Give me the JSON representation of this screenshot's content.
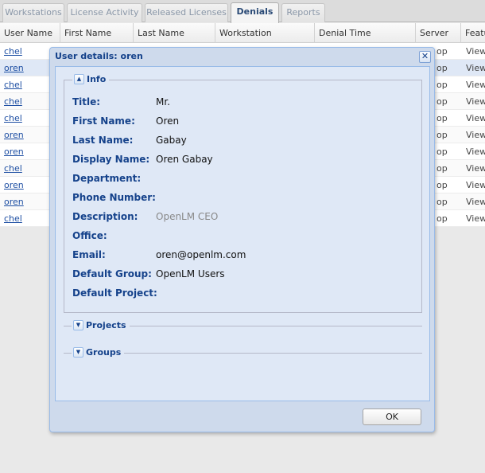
{
  "tabs": [
    {
      "label": "Workstations",
      "active": false
    },
    {
      "label": "License Activity",
      "active": false
    },
    {
      "label": "Released Licenses",
      "active": false
    },
    {
      "label": "Denials",
      "active": true
    },
    {
      "label": "Reports",
      "active": false
    }
  ],
  "grid": {
    "columns": [
      "User Name",
      "First Name",
      "Last Name",
      "Workstation",
      "Denial Time",
      "Server",
      "Featu"
    ],
    "rows": [
      {
        "user": "chel",
        "server": "op",
        "view": "View"
      },
      {
        "user": "oren",
        "server": "op",
        "view": "View"
      },
      {
        "user": "chel",
        "server": "op",
        "view": "View"
      },
      {
        "user": "chel",
        "server": "op",
        "view": "View"
      },
      {
        "user": "chel",
        "server": "op",
        "view": "View"
      },
      {
        "user": "oren",
        "server": "op",
        "view": "View"
      },
      {
        "user": "oren",
        "server": "op",
        "view": "View"
      },
      {
        "user": "chel",
        "server": "op",
        "view": "View"
      },
      {
        "user": "oren",
        "server": "op",
        "view": "View"
      },
      {
        "user": "oren",
        "server": "op",
        "view": "View"
      },
      {
        "user": "chel",
        "server": "op",
        "view": "View"
      }
    ]
  },
  "dialog": {
    "title": "User details: oren",
    "close_glyph": "✕",
    "info": {
      "legend": "Info",
      "toggle_glyph": "▲",
      "fields": [
        {
          "label": "Title:",
          "value": "Mr.",
          "muted": false
        },
        {
          "label": "First Name:",
          "value": "Oren",
          "muted": false
        },
        {
          "label": "Last Name:",
          "value": "Gabay",
          "muted": false
        },
        {
          "label": "Display Name:",
          "value": "Oren Gabay",
          "muted": false
        },
        {
          "label": "Department:",
          "value": "",
          "muted": false
        },
        {
          "label": "Phone Number:",
          "value": "",
          "muted": false
        },
        {
          "label": "Description:",
          "value": "OpenLM CEO",
          "muted": true
        },
        {
          "label": "Office:",
          "value": "",
          "muted": false
        },
        {
          "label": "Email:",
          "value": "oren@openlm.com",
          "muted": false
        },
        {
          "label": "Default Group:",
          "value": "OpenLM Users",
          "muted": false
        },
        {
          "label": "Default Project:",
          "value": "",
          "muted": false
        }
      ]
    },
    "projects": {
      "legend": "Projects",
      "toggle_glyph": "▼"
    },
    "groups": {
      "legend": "Groups",
      "toggle_glyph": "▼"
    },
    "ok_label": "OK"
  },
  "colors": {
    "accent": "#15428b",
    "dialog_body": "#dfe8f6",
    "dialog_frame": "#cedaec",
    "link": "#1e4fa3",
    "selected_row": "#dfe8f6"
  }
}
